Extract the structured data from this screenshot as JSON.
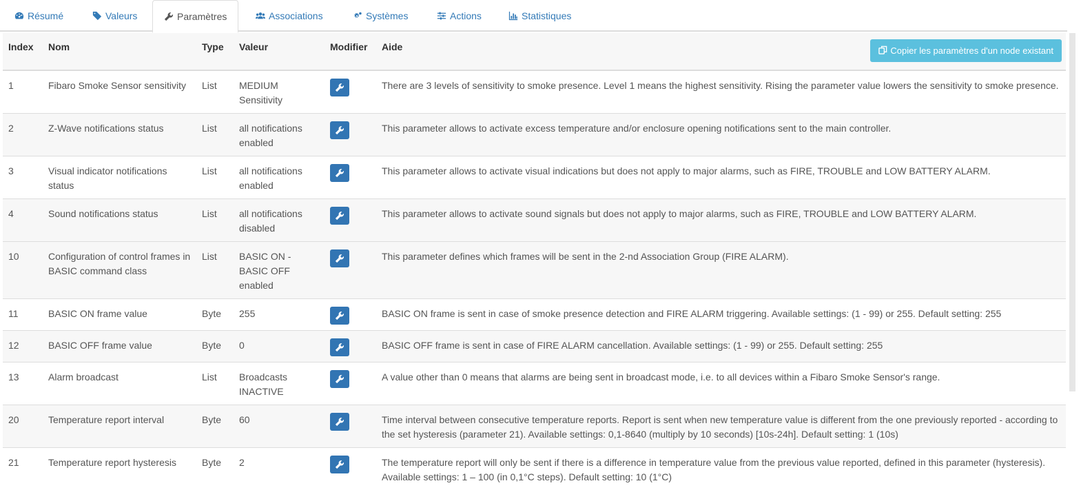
{
  "tabs": [
    {
      "label": "Résumé",
      "icon": "dashboard-icon"
    },
    {
      "label": "Valeurs",
      "icon": "tag-icon"
    },
    {
      "label": "Paramètres",
      "icon": "wrench-icon"
    },
    {
      "label": "Associations",
      "icon": "users-icon"
    },
    {
      "label": "Systèmes",
      "icon": "cogs-icon"
    },
    {
      "label": "Actions",
      "icon": "sliders-icon"
    },
    {
      "label": "Statistiques",
      "icon": "bar-chart-icon"
    }
  ],
  "table": {
    "headers": {
      "index": "Index",
      "name": "Nom",
      "type": "Type",
      "value": "Valeur",
      "modify": "Modifier",
      "help": "Aide"
    },
    "copy_button": "Copier les paramètres d'un node existant",
    "rows": [
      {
        "index": "1",
        "name": "Fibaro Smoke Sensor sensitivity",
        "type": "List",
        "value": "MEDIUM Sensitivity",
        "help": "There are 3 levels of sensitivity to smoke presence. Level 1 means the highest sensitivity. Rising the parameter value lowers the sensitivity to smoke presence."
      },
      {
        "index": "2",
        "name": "Z-Wave notifications status",
        "type": "List",
        "value": "all notifications enabled",
        "help": "This parameter allows to activate excess temperature and/or enclosure opening notifications sent to the main controller."
      },
      {
        "index": "3",
        "name": "Visual indicator notifications status",
        "type": "List",
        "value": "all notifications enabled",
        "help": "This parameter allows to activate visual indications but does not apply to major alarms, such as FIRE, TROUBLE and LOW BATTERY ALARM."
      },
      {
        "index": "4",
        "name": "Sound notifications status",
        "type": "List",
        "value": "all notifications disabled",
        "help": "This parameter allows to activate sound signals but does not apply to major alarms, such as FIRE, TROUBLE and LOW BATTERY ALARM."
      },
      {
        "index": "10",
        "name": "Configuration of control frames in BASIC command class",
        "type": "List",
        "value": "BASIC ON - BASIC OFF enabled",
        "help": "This parameter defines which frames will be sent in the 2-nd Association Group (FIRE ALARM)."
      },
      {
        "index": "11",
        "name": "BASIC ON frame value",
        "type": "Byte",
        "value": "255",
        "help": "BASIC ON frame is sent in case of smoke presence detection and FIRE ALARM triggering. Available settings: (1 - 99) or 255. Default setting: 255"
      },
      {
        "index": "12",
        "name": "BASIC OFF frame value",
        "type": "Byte",
        "value": "0",
        "help": "BASIC OFF frame is sent in case of FIRE ALARM cancellation. Available settings: (1 - 99) or 255. Default setting: 255"
      },
      {
        "index": "13",
        "name": "Alarm broadcast",
        "type": "List",
        "value": "Broadcasts INACTIVE",
        "help": "A value other than 0 means that alarms are being sent in broadcast mode, i.e. to all devices within a Fibaro Smoke Sensor's range."
      },
      {
        "index": "20",
        "name": "Temperature report interval",
        "type": "Byte",
        "value": "60",
        "help": "Time interval between consecutive temperature reports. Report is sent when new temperature value is different from the one previously reported - according to the set hysteresis (parameter 21). Available settings: 0,1-8640 (multiply by 10 seconds) [10s-24h]. Default setting: 1 (10s)"
      },
      {
        "index": "21",
        "name": "Temperature report hysteresis",
        "type": "Byte",
        "value": "2",
        "help": "The temperature report will only be sent if there is a difference in temperature value from the previous value reported, defined in this parameter (hysteresis). Available settings: 1 – 100 (in 0,1°C steps). Default setting: 10 (1°C)"
      }
    ]
  }
}
